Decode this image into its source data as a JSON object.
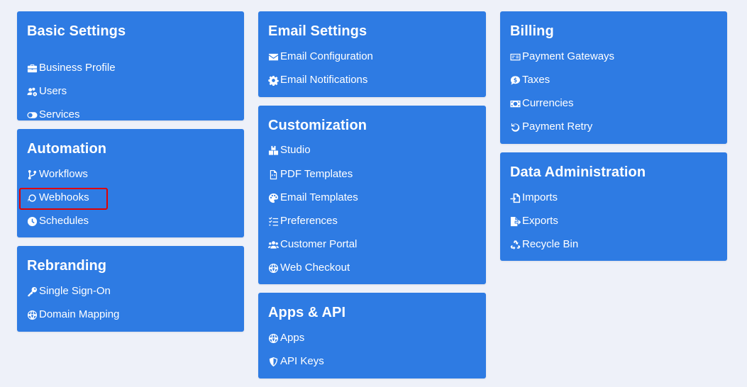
{
  "cards": {
    "basic": {
      "title": "Basic Settings",
      "items": [
        {
          "label": "Business Profile",
          "icon": "briefcase-icon"
        },
        {
          "label": "Users",
          "icon": "users-cog-icon"
        },
        {
          "label": "Services",
          "icon": "toggle-icon"
        }
      ]
    },
    "automation": {
      "title": "Automation",
      "items": [
        {
          "label": "Workflows",
          "icon": "branch-icon"
        },
        {
          "label": "Webhooks",
          "icon": "webhook-icon"
        },
        {
          "label": "Schedules",
          "icon": "clock-icon"
        }
      ]
    },
    "rebranding": {
      "title": "Rebranding",
      "items": [
        {
          "label": "Single Sign-On",
          "icon": "key-icon"
        },
        {
          "label": "Domain Mapping",
          "icon": "globe-icon"
        }
      ]
    },
    "email": {
      "title": "Email Settings",
      "items": [
        {
          "label": "Email Configuration",
          "icon": "envelope-icon"
        },
        {
          "label": "Email Notifications",
          "icon": "gear-icon"
        }
      ]
    },
    "customization": {
      "title": "Customization",
      "items": [
        {
          "label": "Studio",
          "icon": "boxes-icon"
        },
        {
          "label": "PDF Templates",
          "icon": "file-code-icon"
        },
        {
          "label": "Email Templates",
          "icon": "palette-icon"
        },
        {
          "label": "Preferences",
          "icon": "list-check-icon"
        },
        {
          "label": "Customer Portal",
          "icon": "users-icon"
        },
        {
          "label": "Web Checkout",
          "icon": "globe-icon"
        }
      ]
    },
    "apps": {
      "title": "Apps & API",
      "items": [
        {
          "label": "Apps",
          "icon": "globe-icon"
        },
        {
          "label": "API Keys",
          "icon": "shield-icon"
        }
      ]
    },
    "billing": {
      "title": "Billing",
      "items": [
        {
          "label": "Payment Gateways",
          "icon": "money-check-icon"
        },
        {
          "label": "Taxes",
          "icon": "comment-dollar-icon"
        },
        {
          "label": "Currencies",
          "icon": "money-bill-icon"
        },
        {
          "label": "Payment Retry",
          "icon": "undo-icon"
        }
      ]
    },
    "data": {
      "title": "Data Administration",
      "items": [
        {
          "label": "Imports",
          "icon": "file-import-icon"
        },
        {
          "label": "Exports",
          "icon": "file-export-icon"
        },
        {
          "label": "Recycle Bin",
          "icon": "recycle-icon"
        }
      ]
    }
  },
  "colors": {
    "card_bg": "#2e7be3",
    "page_bg": "#eef1f9",
    "highlight": "#e00000"
  }
}
